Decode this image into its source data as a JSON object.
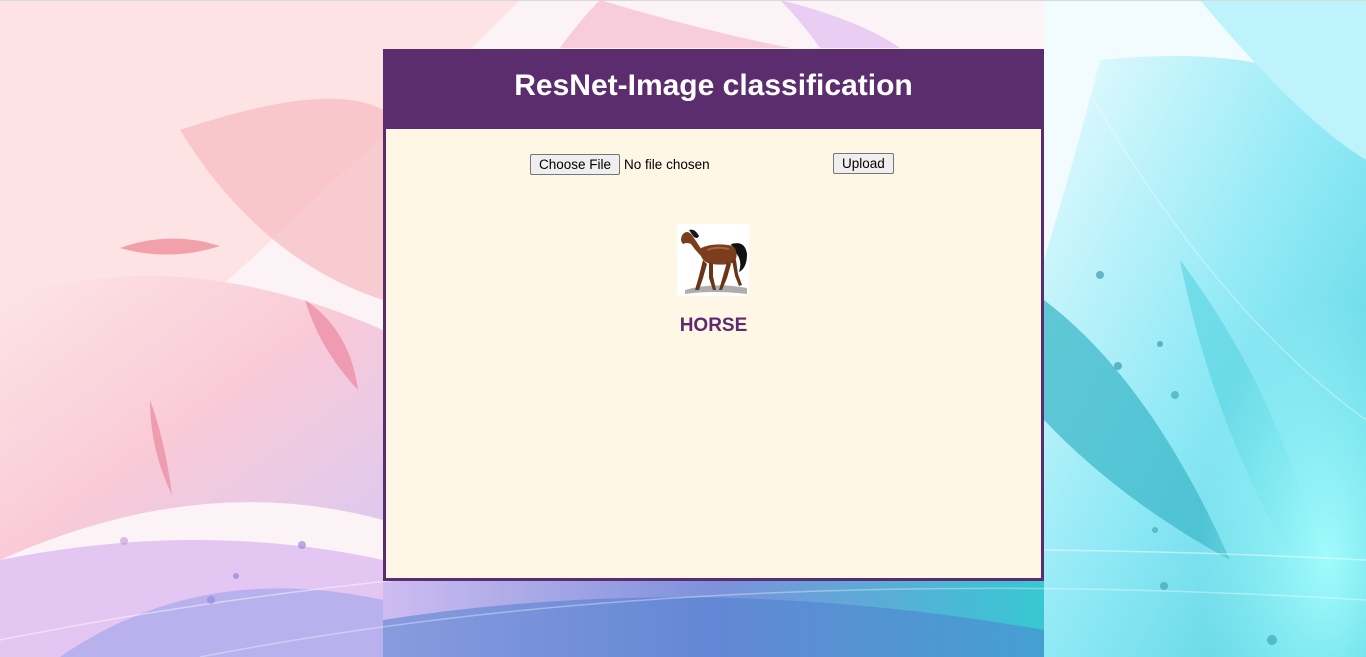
{
  "header": {
    "title": "ResNet-Image classification"
  },
  "upload_form": {
    "choose_file_label": "Choose File",
    "file_status": "No file chosen",
    "upload_label": "Upload"
  },
  "result": {
    "image_icon": "horse-image",
    "prediction": "HORSE"
  },
  "colors": {
    "brand_purple": "#5c2d6e",
    "panel_background": "#fff7e6",
    "header_text": "#ffffff"
  }
}
